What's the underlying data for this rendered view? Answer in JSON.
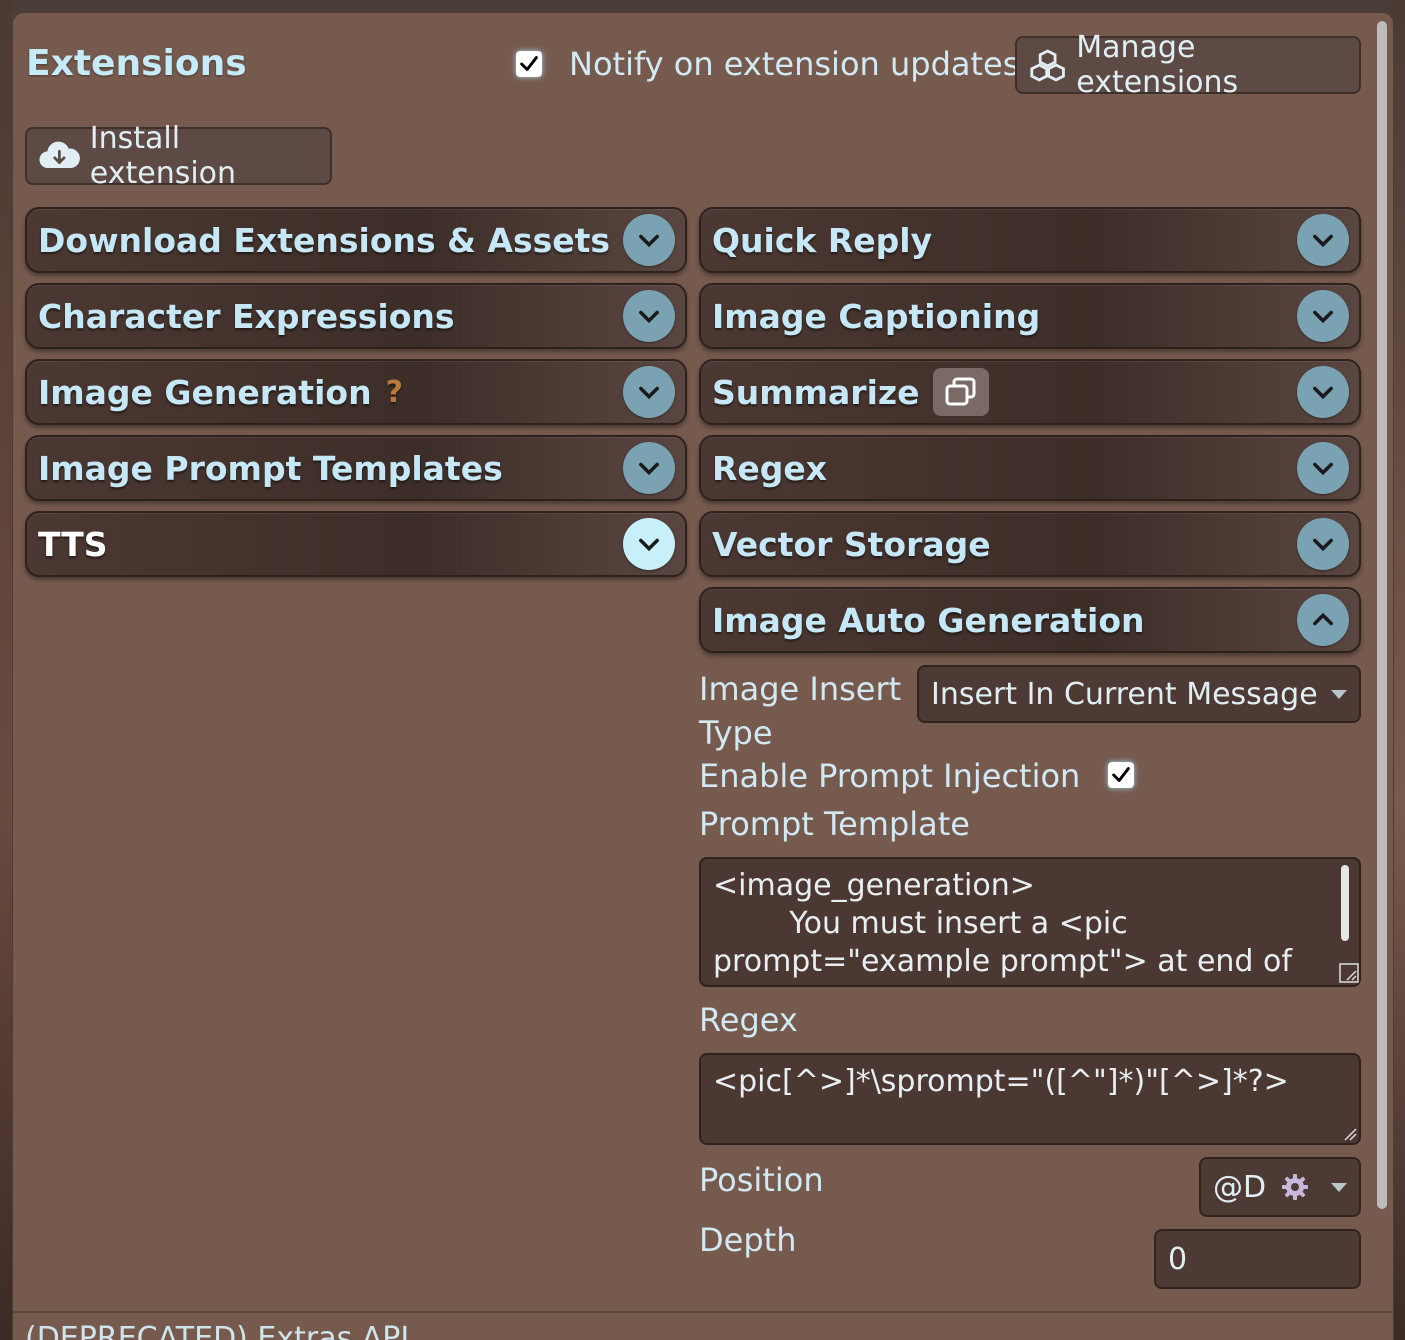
{
  "header": {
    "title": "Extensions",
    "notify_checked": true,
    "notify_label": "Notify on extension updates",
    "manage_label": "Manage extensions",
    "install_label": "Install extension"
  },
  "drawers_left": [
    {
      "label": "Download Extensions & Assets"
    },
    {
      "label": "Character Expressions"
    },
    {
      "label": "Image Generation",
      "help": "?"
    },
    {
      "label": "Image Prompt Templates"
    },
    {
      "label": "TTS"
    }
  ],
  "drawers_right": [
    {
      "label": "Quick Reply"
    },
    {
      "label": "Image Captioning"
    },
    {
      "label": "Summarize"
    },
    {
      "label": "Regex"
    },
    {
      "label": "Vector Storage"
    },
    {
      "label": "Image Auto Generation",
      "expanded": true
    }
  ],
  "auto_gen": {
    "insert_type_label": "Image Insert Type",
    "insert_type_value": "Insert In Current Message",
    "prompt_injection_label": "Enable Prompt Injection",
    "prompt_injection_checked": true,
    "prompt_template_label": "Prompt Template",
    "prompt_template_value": "<image_generation>\n        You must insert a <pic\nprompt=\"example prompt\"> at end of the",
    "regex_label": "Regex",
    "regex_value": "<pic[^>]*\\sprompt=\"([^\"]*)\"[^>]*?>",
    "position_label": "Position",
    "position_value": "@D",
    "depth_label": "Depth",
    "depth_value": "0"
  },
  "footer": {
    "partial_text": "(DEPRECATED) Extras API"
  },
  "colors": {
    "panel_bg": "#765a4e",
    "accent": "#c5eaf8",
    "drawer_bg": "#3d2d28"
  }
}
